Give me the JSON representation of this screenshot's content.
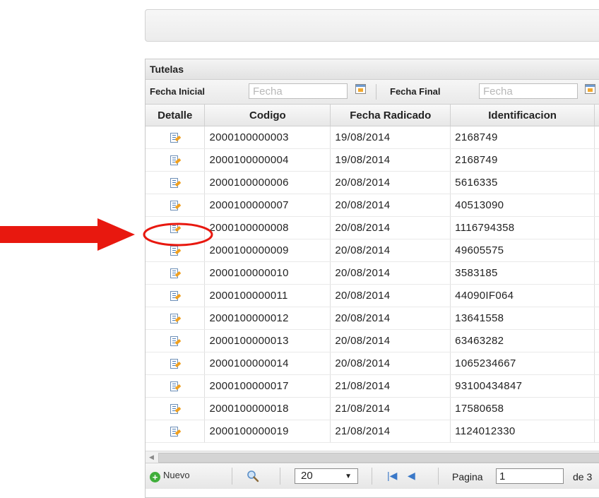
{
  "panel": {
    "title": "Tutelas"
  },
  "filters": {
    "start_label": "Fecha Inicial",
    "start_placeholder": "Fecha",
    "end_label": "Fecha Final",
    "end_placeholder": "Fecha"
  },
  "columns": [
    "Detalle",
    "Codigo",
    "Fecha Radicado",
    "Identificacion"
  ],
  "rows": [
    {
      "codigo": "2000100000003",
      "fecha": "19/08/2014",
      "id": "2168749"
    },
    {
      "codigo": "2000100000004",
      "fecha": "19/08/2014",
      "id": "2168749"
    },
    {
      "codigo": "2000100000006",
      "fecha": "20/08/2014",
      "id": "5616335"
    },
    {
      "codigo": "2000100000007",
      "fecha": "20/08/2014",
      "id": "40513090"
    },
    {
      "codigo": "2000100000008",
      "fecha": "20/08/2014",
      "id": "1116794358"
    },
    {
      "codigo": "2000100000009",
      "fecha": "20/08/2014",
      "id": "49605575"
    },
    {
      "codigo": "2000100000010",
      "fecha": "20/08/2014",
      "id": "3583185"
    },
    {
      "codigo": "2000100000011",
      "fecha": "20/08/2014",
      "id": "44090IF064"
    },
    {
      "codigo": "2000100000012",
      "fecha": "20/08/2014",
      "id": "13641558"
    },
    {
      "codigo": "2000100000013",
      "fecha": "20/08/2014",
      "id": "63463282"
    },
    {
      "codigo": "2000100000014",
      "fecha": "20/08/2014",
      "id": "1065234667"
    },
    {
      "codigo": "2000100000017",
      "fecha": "21/08/2014",
      "id": "93100434847"
    },
    {
      "codigo": "2000100000018",
      "fecha": "21/08/2014",
      "id": "17580658"
    },
    {
      "codigo": "2000100000019",
      "fecha": "21/08/2014",
      "id": "1124012330"
    }
  ],
  "detail_icon": "edit-document-icon",
  "highlighted_row": 4,
  "pager": {
    "new_label": "Nuevo",
    "page_size": "20",
    "page_label": "Pagina",
    "page_value": "1",
    "of_label": "de 3"
  },
  "annotation_color": "#e8180f"
}
